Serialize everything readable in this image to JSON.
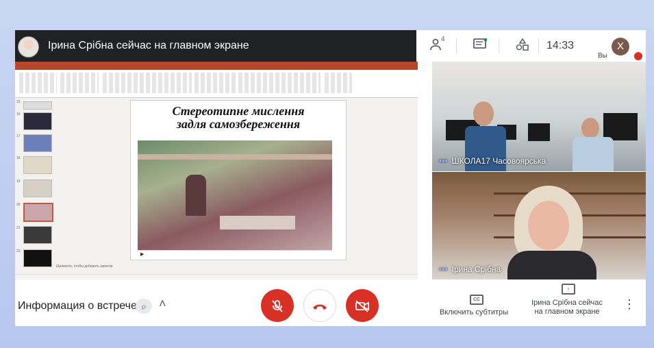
{
  "header": {
    "presenter_title": "Ірина Срібна сейчас на главном экране",
    "participants_count": "4",
    "time": "14:33",
    "me_initial": "Х",
    "me_label": "Вы"
  },
  "slide": {
    "title_line1": "Стереотипне мислення",
    "title_line2": "задля самозбереження",
    "notes_placeholder": "Щелкните, чтобы добавить заметки",
    "thumb_numbers": [
      "15",
      "16",
      "17",
      "18",
      "19",
      "20",
      "21",
      "22"
    ]
  },
  "tiles": [
    {
      "name": "ШКОЛА17 Часовоярська"
    },
    {
      "name": "Ірина Срібна"
    }
  ],
  "bottom": {
    "meeting_info": "Информация о встрече",
    "captions_label": "Включить субтитры",
    "presenting_label": "Ірина Срібна сейчас на главном экране"
  },
  "colors": {
    "danger": "#d93025",
    "dark_bar": "#202124",
    "ppt_accent": "#b7472a"
  },
  "icons": {
    "participants": "people-icon",
    "chat": "chat-icon",
    "activities": "shapes-icon",
    "mic_off": "mic-off-icon",
    "end_call": "phone-hangup-icon",
    "camera_off": "camera-off-icon",
    "captions": "cc-icon",
    "present": "present-icon",
    "more": "more-vert-icon"
  }
}
